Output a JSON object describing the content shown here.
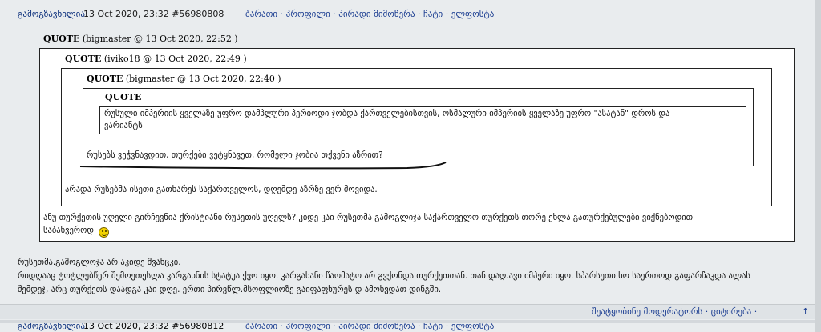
{
  "post": {
    "author": "გამოგზავნილია:",
    "meta": "13 Oct 2020, 23:32  #56980808",
    "links": "ბარათი · პროფილი · პირადი მიმოწერა · ჩატი · ელფოსტა"
  },
  "quotes": {
    "level1": {
      "label": "QUOTE",
      "source": "(bigmaster @ 13 Oct 2020, 22:52 )"
    },
    "level2": {
      "label": "QUOTE",
      "source": "(iviko18 @ 13 Oct 2020, 22:49 )"
    },
    "level3": {
      "label": "QUOTE",
      "source": "(bigmaster @ 13 Oct 2020, 22:40 )"
    },
    "level4": {
      "label": "QUOTE",
      "text_line1": "რუსული იმპერიის ყველაზე უფრო დამპლური პერიოდი ჯობდა ქართველებისთვის, ოსმალური იმპერიის ყველაზე უფრო \"ასატან\" დროს და",
      "text_line2": "ვარიანტს"
    },
    "level3_text": "რუსებს ვეჭვნავდით, თურქები ვეტყნავეთ, რომელი ჯობია თქვენი აზრით?",
    "level2_text": "არადა რუსებმა ისეთი გათხარეს საქართველოს, დღემდე აზრზე ვერ მოვიდა.",
    "level1_text_line1": "ანუ თურქეთის უღელი გირჩევნია ქრისტიანი რუსეთის უღელს? კიდე კაი რუსეთმა გამოგლიჯა საქართველო თურქეთს თორე ეხლა გათურქებულები ვიქნებოდით",
    "level1_text_line2": "საბახვეროდ"
  },
  "body": {
    "line1": "რუსეთმა.გამოგლოჯა არ აკიდე შვანცკი.",
    "line2": "რიდღააც ტოტლებწერ შემოეთესლა კარგახნის სტატუა ქვო იყო. კარგახანი წაომატო არ გვქონდა თურქეთთან. თან დაღ.ავი იმპერი იყო. სპარსეთი ხო საერთოდ გაფარჩაკდა ალას",
    "line3": "შემდეჯ, არც თურქეთს დაადგა კაი დღე. ერთი პირვწლ.მსოფლიოზე გაიფაფხურეს დ ამოხვდათ დინგში."
  },
  "footer": {
    "links": "შეატყობინე მოდერატორს  ·  ციტირება  ·",
    "up": "↑"
  },
  "next_post": {
    "author": "გამოგზავნილია:",
    "meta": "13 Oct 2020, 23:32  #56980812",
    "links": "ბარათი · პროფილი · პირადი მიმოწერა · ჩატი · ელფოსტა"
  }
}
